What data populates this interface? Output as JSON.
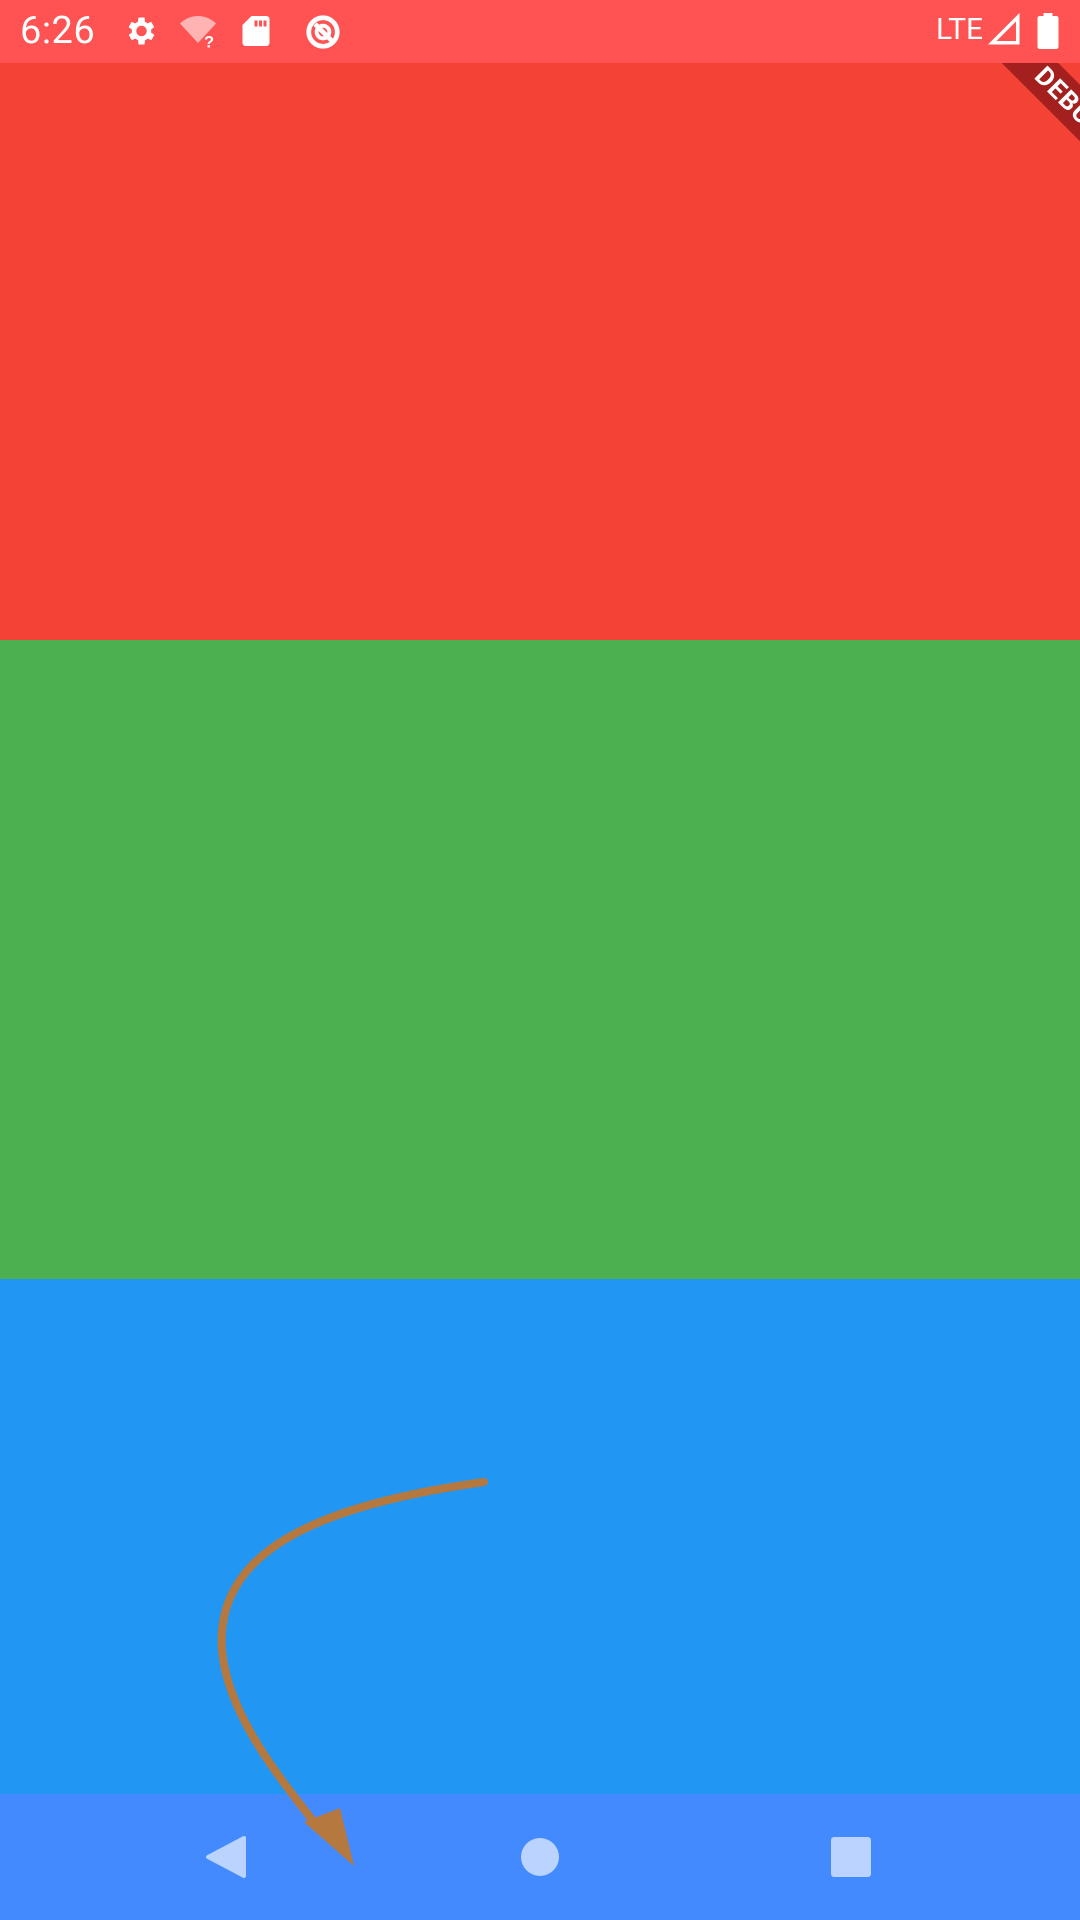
{
  "status_bar": {
    "time": "6:26",
    "network_label": "LTE",
    "icons": [
      "settings-icon",
      "wifi-unknown-icon",
      "sd-card-icon",
      "data-saver-icon",
      "signal-icon",
      "battery-icon"
    ],
    "background": "#FF5252"
  },
  "debug_banner": {
    "label": "DEBUG",
    "color": "#A3201F"
  },
  "content": {
    "blocks": [
      {
        "name": "red-block",
        "color": "#F44336"
      },
      {
        "name": "green-block",
        "color": "#4CAF50"
      },
      {
        "name": "blue-block",
        "color": "#2196F3"
      }
    ]
  },
  "annotation": {
    "type": "curved-arrow",
    "color": "#B5793F",
    "points_to": "back-button"
  },
  "nav_bar": {
    "background": "#448AFF",
    "buttons": [
      "back-button",
      "home-button",
      "recents-button"
    ]
  }
}
